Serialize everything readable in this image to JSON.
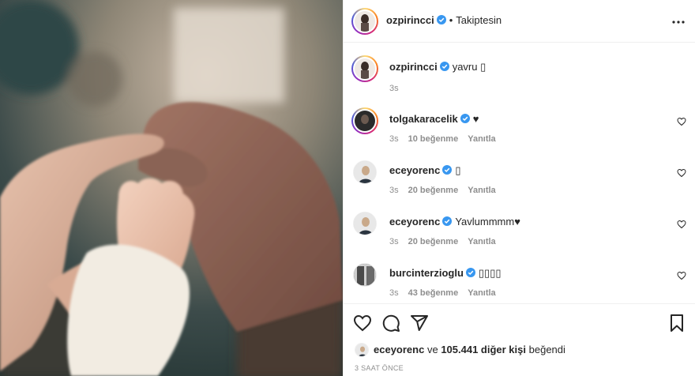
{
  "post": {
    "author": "ozpirincci",
    "follow_state": "Takiptesin",
    "dot": "•",
    "caption_text": "yavru",
    "caption_emoji": "▯",
    "caption_age": "3s",
    "photo_icon": "hands-photo"
  },
  "comments": [
    {
      "user": "tolgakaracelik",
      "text": "♥",
      "age": "3s",
      "likes": "10 beğenme",
      "reply": "Yanıtla",
      "verified": true
    },
    {
      "user": "eceyorenc",
      "text": "▯",
      "age": "3s",
      "likes": "20 beğenme",
      "reply": "Yanıtla",
      "verified": true
    },
    {
      "user": "eceyorenc",
      "text": "Yavlummmm♥",
      "age": "3s",
      "likes": "20 beğenme",
      "reply": "Yanıtla",
      "verified": true
    },
    {
      "user": "burcinterzioglu",
      "text": "▯▯▯▯",
      "age": "3s",
      "likes": "43 beğenme",
      "reply": "Yanıtla",
      "verified": true
    }
  ],
  "likes_line": {
    "user": "eceyorenc",
    "middle": "ve",
    "count": "105.441 diğer kişi",
    "suffix": "beğendi"
  },
  "timestamp": "3 SAAT ÖNCE",
  "colors": {
    "verified_blue": "#3897f0",
    "text": "#262626",
    "muted": "#8e8e8e"
  },
  "icons": [
    "heart-icon",
    "comment-icon",
    "share-icon",
    "bookmark-icon",
    "more-icon",
    "verified-icon"
  ]
}
